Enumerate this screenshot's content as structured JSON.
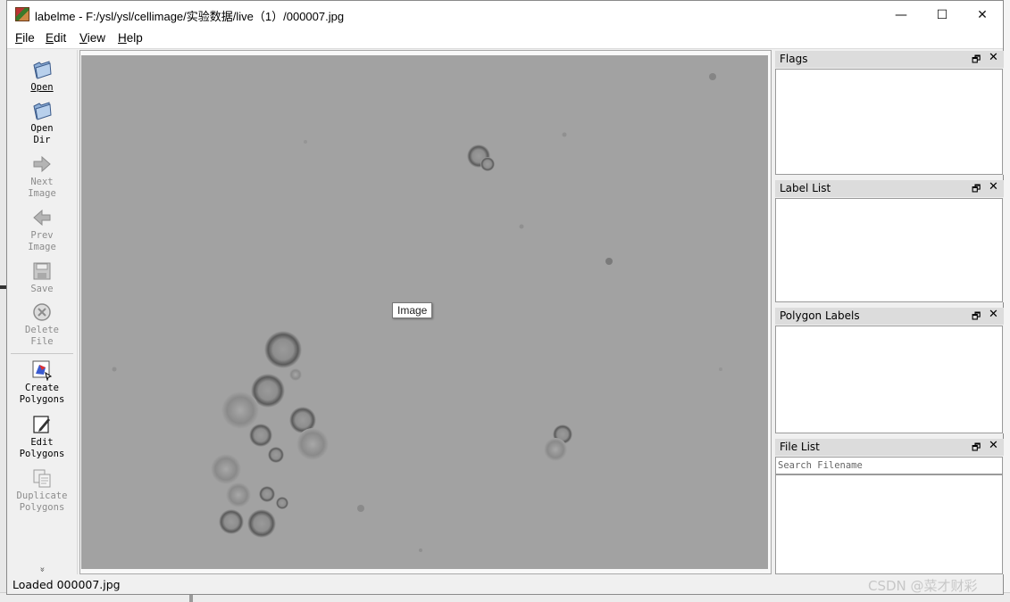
{
  "window": {
    "title": "labelme - F:/ysl/ysl/cellimage/实验数据/live（1）/000007.jpg",
    "minimize_glyph": "—",
    "maximize_glyph": "☐",
    "close_glyph": "✕"
  },
  "menu": {
    "file": {
      "first": "F",
      "rest": "ile"
    },
    "edit": {
      "first": "E",
      "rest": "dit"
    },
    "view": {
      "first": "V",
      "rest": "iew"
    },
    "help": {
      "first": "H",
      "rest": "elp"
    }
  },
  "toolbar": {
    "open": {
      "l1": "Open",
      "icon": "folder-open-icon"
    },
    "open_dir": {
      "l1": "Open",
      "l2": "Dir",
      "icon": "folder-open-icon"
    },
    "next_image": {
      "l1": "Next",
      "l2": "Image",
      "icon": "arrow-right-icon",
      "enabled": false
    },
    "prev_image": {
      "l1": "Prev",
      "l2": "Image",
      "icon": "arrow-left-icon",
      "enabled": false
    },
    "save": {
      "l1": "Save",
      "icon": "save-icon",
      "enabled": false
    },
    "delete_file": {
      "l1": "Delete",
      "l2": "File",
      "icon": "delete-icon",
      "enabled": false
    },
    "create_polygons": {
      "l1": "Create",
      "l2": "Polygons",
      "icon": "create-polygon-icon"
    },
    "edit_polygons": {
      "l1": "Edit",
      "l2": "Polygons",
      "icon": "edit-icon"
    },
    "duplicate_polygons": {
      "l1": "Duplicate",
      "l2": "Polygons",
      "icon": "copy-icon",
      "enabled": false
    },
    "more_glyph": "»"
  },
  "canvas": {
    "tooltip": "Image"
  },
  "docks": {
    "flags": {
      "title": "Flags"
    },
    "label_list": {
      "title": "Label List"
    },
    "polygon_labels": {
      "title": "Polygon Labels"
    },
    "file_list": {
      "title": "File List",
      "search_placeholder": "Search Filename"
    },
    "float_glyph": "🗗",
    "close_glyph": "✕"
  },
  "status": {
    "message": "Loaded 000007.jpg",
    "watermark": "CSDN @菜才财彩"
  },
  "colors": {
    "canvas_bg": "#a2a2a2",
    "dock_title_bg": "#dcdcdc"
  }
}
